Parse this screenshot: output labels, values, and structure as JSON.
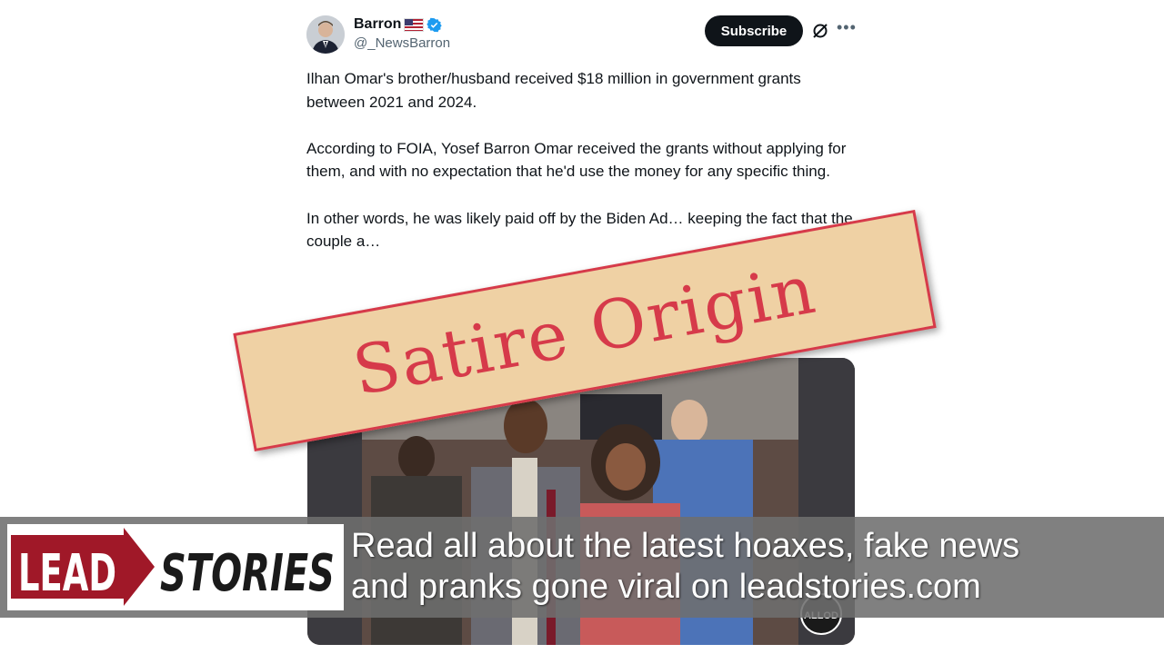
{
  "author": {
    "name": "Barron",
    "handle": "@_NewsBarron"
  },
  "actions": {
    "subscribe_label": "Subscribe"
  },
  "tweet": {
    "paragraphs": [
      "Ilhan Omar's brother/husband received $18 million in government grants between 2021 and 2024.",
      "According to FOIA, Yosef Barron Omar received the grants without applying for them, and with no expectation that he'd use the money for any specific thing.",
      "In other words, he was likely paid off by the Biden Ad… keeping the fact that the couple a…"
    ]
  },
  "overlay": {
    "stamp": "Satire Origin",
    "photo_watermark": "ALLOD"
  },
  "banner": {
    "logo_left": "LEAD",
    "logo_right": "STORIES",
    "line1": "Read all about the latest hoaxes, fake news",
    "line2": "and pranks gone viral on leadstories.com"
  },
  "colors": {
    "stamp_red": "#d63a4a",
    "stamp_bg": "#efd1a4",
    "verified_blue": "#1d9bf0",
    "logo_red": "#a01828"
  }
}
